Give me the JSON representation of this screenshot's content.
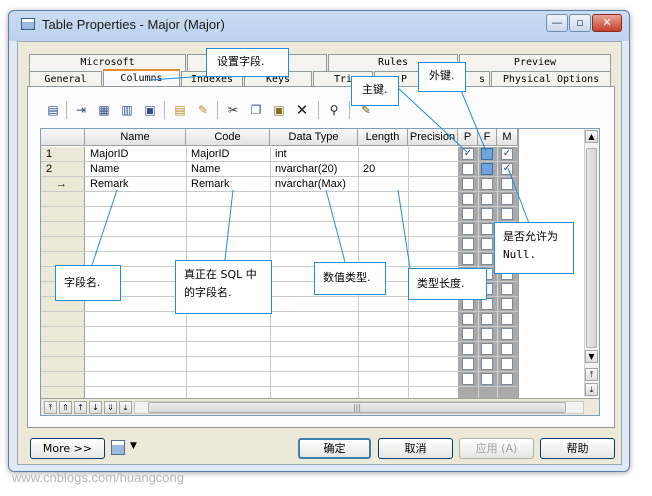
{
  "window": {
    "title": "Table Properties - Major (Major)",
    "minimize_glyph": "—",
    "maximize_glyph": "▫",
    "close_glyph": "✕"
  },
  "tabs_row1": [
    "Microsoft",
    "",
    "Rules",
    "Preview"
  ],
  "tabs_row2": [
    "General",
    "Columns",
    "Indexes",
    "Keys",
    "Tri",
    "P",
    "s",
    "Physical Options"
  ],
  "active_tab": "Columns",
  "toolbar_icons": [
    "properties-icon",
    "insert-row-icon",
    "add-row-icon",
    "add-columns-icon",
    "delete-columns-icon",
    "paste-icon",
    "customize-icon",
    "cut-icon",
    "copy-icon",
    "paste-clipboard-icon",
    "delete-icon",
    "find-icon",
    "edit-icon"
  ],
  "grid": {
    "headers": [
      "Name",
      "Code",
      "Data Type",
      "Length",
      "Precision",
      "P",
      "F",
      "M"
    ],
    "rows": [
      {
        "num": "1",
        "name": "MajorID",
        "code": "MajorID",
        "type": "int",
        "length": "",
        "p": true,
        "f": false,
        "m": true
      },
      {
        "num": "2",
        "name": "Name",
        "code": "Name",
        "type": "nvarchar(20)",
        "length": "20",
        "p": false,
        "f": false,
        "m": true
      },
      {
        "num": "→",
        "name": "Remark",
        "code": "Remark",
        "type": "nvarchar(Max)",
        "length": "",
        "p": false,
        "f": false,
        "m": false
      }
    ]
  },
  "callouts": {
    "set_field": "设置字段.",
    "primary_key": "主键.",
    "foreign_key": "外键.",
    "nullable_line1": "是否允许为",
    "nullable_line2": "Null.",
    "field_name": "字段名.",
    "sql_name_line1": "真正在 SQL 中",
    "sql_name_line2": "的字段名.",
    "data_type": "数值类型.",
    "type_length": "类型长度."
  },
  "buttons": {
    "more": "More >>",
    "ok": "确定",
    "cancel": "取消",
    "apply": "应用 (A)",
    "help": "帮助"
  },
  "watermark": "www.cnblogs.com/huangcong"
}
